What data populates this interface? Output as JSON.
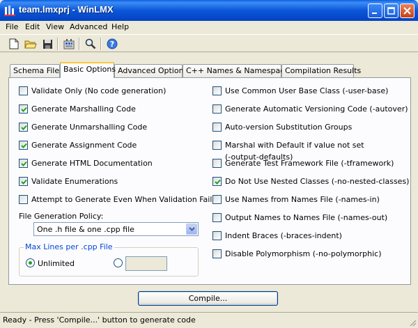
{
  "window": {
    "title": "team.lmxprj - WinLMX"
  },
  "menu": {
    "file": "File",
    "edit": "Edit",
    "view": "View",
    "advanced": "Advanced",
    "help": "Help"
  },
  "toolbar": {
    "icons": [
      "new-icon",
      "open-icon",
      "save-icon",
      "build-icon",
      "find-icon",
      "help-icon"
    ]
  },
  "tabs": [
    {
      "label": "Schema Files"
    },
    {
      "label": "Basic Options"
    },
    {
      "label": "Advanced Options"
    },
    {
      "label": "C++ Names & Namespaces"
    },
    {
      "label": "Compilation Results"
    }
  ],
  "active_tab": "Basic Options",
  "left_options": [
    {
      "label": "Validate Only (No code generation)",
      "checked": false
    },
    {
      "label": "Generate Marshalling Code",
      "checked": true
    },
    {
      "label": "Generate Unmarshalling Code",
      "checked": true
    },
    {
      "label": "Generate Assignment Code",
      "checked": true
    },
    {
      "label": "Generate HTML Documentation",
      "checked": true
    },
    {
      "label": "Validate Enumerations",
      "checked": true
    },
    {
      "label": "Attempt to Generate Even When Validation Fails",
      "checked": false
    }
  ],
  "right_options": [
    {
      "label": "Use Common User Base Class (-user-base)",
      "checked": false
    },
    {
      "label": "Generate Automatic Versioning Code (-autover)",
      "checked": false
    },
    {
      "label": "Auto-version Substitution Groups",
      "checked": false
    },
    {
      "label": "Marshal with Default if value not set",
      "label2": "(-output-defaults)",
      "checked": false
    },
    {
      "label": "Generate Test Framework File (-tframework)",
      "checked": false
    },
    {
      "label": "Do Not Use Nested Classes (-no-nested-classes)",
      "checked": true
    },
    {
      "label": "Use Names from Names File (-names-in)",
      "checked": false
    },
    {
      "label": "Output Names to Names File (-names-out)",
      "checked": false
    },
    {
      "label": "Indent Braces (-braces-indent)",
      "checked": false
    },
    {
      "label": "Disable Polymorphism (-no-polymorphic)",
      "checked": false
    }
  ],
  "file_policy": {
    "label": "File Generation Policy:",
    "value": "One .h file & one .cpp file"
  },
  "max_lines": {
    "group_title": "Max Lines per .cpp File",
    "unlimited_label": "Unlimited",
    "unlimited_selected": true,
    "custom_value": ""
  },
  "compile_button": "Compile...",
  "status": "Ready - Press 'Compile...' button to generate code",
  "colors": {
    "titlebar": "#0a57d8",
    "check": "#21a121",
    "group_title": "#0046d5",
    "tab_highlight": "#ffc83c"
  }
}
